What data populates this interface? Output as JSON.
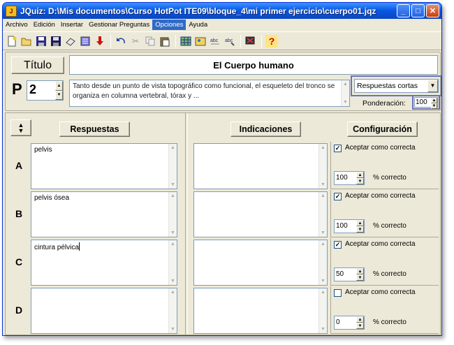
{
  "window": {
    "title": "JQuiz: D:\\Mis documentos\\Curso HotPot ITE09\\bloque_4\\mi primer ejercicio\\cuerpo01.jqz",
    "app_icon": "J"
  },
  "menu": [
    "Archivo",
    "Edición",
    "Insertar",
    "Gestionar Preguntas",
    "Opciones",
    "Ayuda"
  ],
  "menu_active": "Opciones",
  "toolbar_icons": [
    "new-file-icon",
    "open-folder-icon",
    "save-icon",
    "save-as-icon",
    "eraser-icon",
    "web-page-icon",
    "down-arrow-icon",
    "undo-icon",
    "cut-icon",
    "copy-icon",
    "paste-icon",
    "grid-export-icon",
    "image-insert-icon",
    "abc-config-icon",
    "abc-tools-icon",
    "monitor-icon",
    "help-icon"
  ],
  "header": {
    "titulo_button": "Título",
    "titulo_value": "El Cuerpo humano",
    "p_label": "P",
    "question_number": "2",
    "question_text": "Tanto desde un punto de vista topográfico como funcional, el esqueleto del tronco se organiza en columna vertebral, tórax y ...",
    "question_type": "Respuestas cortas",
    "ponderacion_label": "Ponderación:",
    "ponderacion_value": "100"
  },
  "columns": {
    "respuestas": "Respuestas",
    "indicaciones": "Indicaciones",
    "configuracion": "Configuración"
  },
  "answers": [
    {
      "letter": "A",
      "text": "pelvis",
      "accept_label": "Aceptar como correcta",
      "accepted": true,
      "percent": "100",
      "percent_label": "% correcto"
    },
    {
      "letter": "B",
      "text": "pelvis ósea",
      "accept_label": "Aceptar como correcta",
      "accepted": true,
      "percent": "100",
      "percent_label": "% correcto"
    },
    {
      "letter": "C",
      "text": "cintura pélvica",
      "accept_label": "Aceptar como correcta",
      "accepted": true,
      "percent": "50",
      "percent_label": "% correcto"
    },
    {
      "letter": "D",
      "text": "",
      "accept_label": "Aceptar como correcta",
      "accepted": false,
      "percent": "0",
      "percent_label": "% correcto"
    }
  ],
  "colors": {
    "titlebar": "#0a5ae6",
    "menu_highlight": "#316ac5",
    "window_bg": "#ece9d8",
    "focus_border": "#6a72b8"
  }
}
